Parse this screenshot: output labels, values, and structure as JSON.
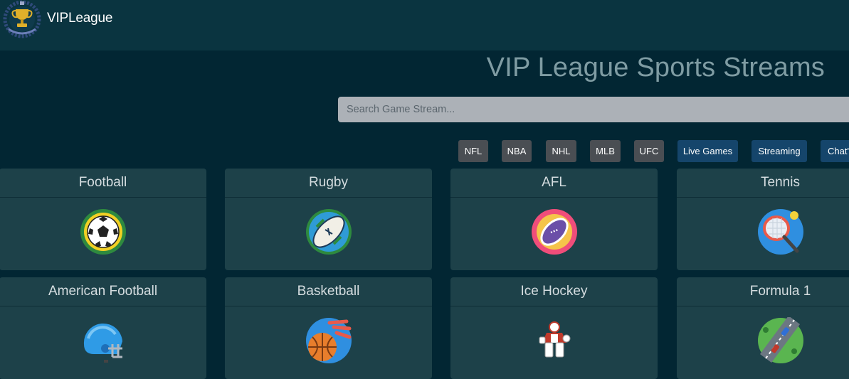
{
  "navbar": {
    "brand": "VIPLeague"
  },
  "main": {
    "title": "VIP League Sports Streams",
    "search_placeholder": "Search Game Stream..."
  },
  "quick_links": [
    {
      "label": "NFL",
      "style": "gray"
    },
    {
      "label": "NBA",
      "style": "gray"
    },
    {
      "label": "NHL",
      "style": "gray"
    },
    {
      "label": "MLB",
      "style": "gray"
    },
    {
      "label": "UFC",
      "style": "gray"
    },
    {
      "label": "Live Games",
      "style": "blue"
    },
    {
      "label": "Streaming",
      "style": "blue"
    },
    {
      "label": "Chat'",
      "style": "blue"
    }
  ],
  "sports": [
    {
      "name": "Football",
      "icon": "soccer-ball-icon"
    },
    {
      "name": "Rugby",
      "icon": "rugby-ball-icon"
    },
    {
      "name": "AFL",
      "icon": "afl-ball-icon"
    },
    {
      "name": "Tennis",
      "icon": "tennis-racket-icon"
    },
    {
      "name": "American Football",
      "icon": "football-helmet-icon"
    },
    {
      "name": "Basketball",
      "icon": "basketball-icon"
    },
    {
      "name": "Ice Hockey",
      "icon": "hockey-goalie-icon"
    },
    {
      "name": "Formula 1",
      "icon": "race-track-icon"
    }
  ],
  "colors": {
    "background": "#022633",
    "navbar": "#0a3440",
    "card": "#1d4149",
    "chip_gray": "#4a4e53",
    "chip_blue": "#15456b"
  }
}
